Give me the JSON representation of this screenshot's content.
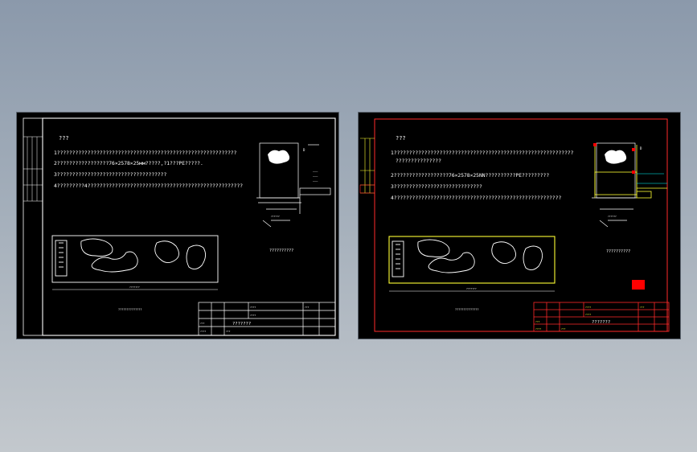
{
  "left_sheet": {
    "notes_heading": "???",
    "notes": [
      "1???????????????????????????????????????????????????????????",
      "2?????????????????76×2578×25мм?????,?1???PE?????.",
      "3????????????????????????????????????",
      "4?????????4???????????????????????????????????????????????????"
    ],
    "dimension_label": "???????",
    "section_label": "??????????",
    "section_caption": "??????",
    "plan_caption": "??????????????",
    "title_block": {
      "title": "???????",
      "cells": [
        "????",
        "????",
        "???",
        "???",
        "????",
        "???"
      ]
    },
    "colors": {
      "line": "#ffffff",
      "text": "#ffffff"
    }
  },
  "right_sheet": {
    "notes_heading": "???",
    "notes": [
      "1???????????????????????????????????????????????????????????",
      "???????????????",
      "2??????????????????76×2578×25NN??????????PE?????????",
      "3?????????????????????????????",
      "4???????????????????????????????????????????????????????"
    ],
    "dimension_label": "???????",
    "section_label": "??????????",
    "section_caption": "??????",
    "plan_caption": "??????????????",
    "title_block": {
      "title": "???????",
      "cells": [
        "????",
        "????",
        "???",
        "???",
        "????",
        "???"
      ]
    },
    "colors": {
      "frame": "#ff2a2a",
      "text": "#ffffff",
      "highlight": "#ffff33",
      "accent": "#00ffff",
      "mark": "#ff0000"
    }
  }
}
